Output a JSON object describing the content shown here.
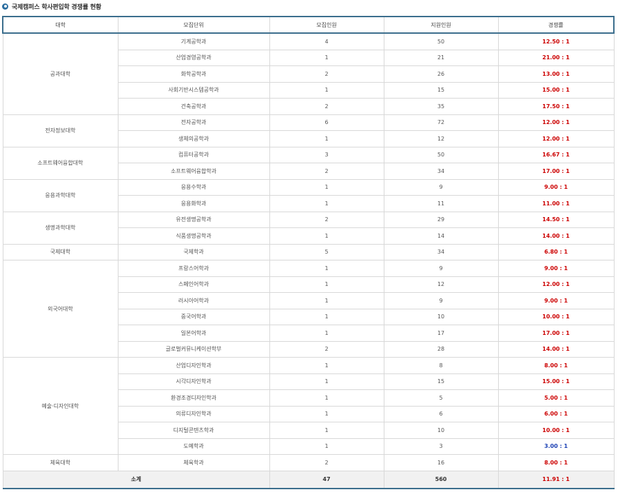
{
  "title": "국제캠퍼스 학사편입학 경쟁률 현황",
  "headers": [
    "대학",
    "모집단위",
    "모집인원",
    "지원인원",
    "경쟁률"
  ],
  "colleges": [
    {
      "name": "공과대학",
      "rows": [
        {
          "dept": "기계공학과",
          "quota": "4",
          "applicants": "50",
          "rate": "12.50 : 1"
        },
        {
          "dept": "산업경영공학과",
          "quota": "1",
          "applicants": "21",
          "rate": "21.00 : 1"
        },
        {
          "dept": "화학공학과",
          "quota": "2",
          "applicants": "26",
          "rate": "13.00 : 1"
        },
        {
          "dept": "사회기반시스템공학과",
          "quota": "1",
          "applicants": "15",
          "rate": "15.00 : 1"
        },
        {
          "dept": "건축공학과",
          "quota": "2",
          "applicants": "35",
          "rate": "17.50 : 1"
        }
      ]
    },
    {
      "name": "전자정보대학",
      "rows": [
        {
          "dept": "전자공학과",
          "quota": "6",
          "applicants": "72",
          "rate": "12.00 : 1"
        },
        {
          "dept": "생체의공학과",
          "quota": "1",
          "applicants": "12",
          "rate": "12.00 : 1"
        }
      ]
    },
    {
      "name": "소프트웨어융합대학",
      "rows": [
        {
          "dept": "컴퓨터공학과",
          "quota": "3",
          "applicants": "50",
          "rate": "16.67 : 1"
        },
        {
          "dept": "소프트웨어융합학과",
          "quota": "2",
          "applicants": "34",
          "rate": "17.00 : 1"
        }
      ]
    },
    {
      "name": "응용과학대학",
      "rows": [
        {
          "dept": "응용수학과",
          "quota": "1",
          "applicants": "9",
          "rate": "9.00 : 1"
        },
        {
          "dept": "응용화학과",
          "quota": "1",
          "applicants": "11",
          "rate": "11.00 : 1"
        }
      ]
    },
    {
      "name": "생명과학대학",
      "rows": [
        {
          "dept": "유전생명공학과",
          "quota": "2",
          "applicants": "29",
          "rate": "14.50 : 1"
        },
        {
          "dept": "식품생명공학과",
          "quota": "1",
          "applicants": "14",
          "rate": "14.00 : 1"
        }
      ]
    },
    {
      "name": "국제대학",
      "rows": [
        {
          "dept": "국제학과",
          "quota": "5",
          "applicants": "34",
          "rate": "6.80 : 1"
        }
      ]
    },
    {
      "name": "외국어대학",
      "rows": [
        {
          "dept": "프랑스어학과",
          "quota": "1",
          "applicants": "9",
          "rate": "9.00 : 1"
        },
        {
          "dept": "스페인어학과",
          "quota": "1",
          "applicants": "12",
          "rate": "12.00 : 1"
        },
        {
          "dept": "러시아어학과",
          "quota": "1",
          "applicants": "9",
          "rate": "9.00 : 1"
        },
        {
          "dept": "중국어학과",
          "quota": "1",
          "applicants": "10",
          "rate": "10.00 : 1"
        },
        {
          "dept": "일본어학과",
          "quota": "1",
          "applicants": "17",
          "rate": "17.00 : 1"
        },
        {
          "dept": "글로벌커뮤니케이션학부",
          "quota": "2",
          "applicants": "28",
          "rate": "14.00 : 1"
        }
      ]
    },
    {
      "name": "예술·디자인대학",
      "rows": [
        {
          "dept": "산업디자인학과",
          "quota": "1",
          "applicants": "8",
          "rate": "8.00 : 1"
        },
        {
          "dept": "시각디자인학과",
          "quota": "1",
          "applicants": "15",
          "rate": "15.00 : 1"
        },
        {
          "dept": "환경조경디자인학과",
          "quota": "1",
          "applicants": "5",
          "rate": "5.00 : 1"
        },
        {
          "dept": "의류디자인학과",
          "quota": "1",
          "applicants": "6",
          "rate": "6.00 : 1"
        },
        {
          "dept": "디지털콘텐츠학과",
          "quota": "1",
          "applicants": "10",
          "rate": "10.00 : 1"
        },
        {
          "dept": "도예학과",
          "quota": "1",
          "applicants": "3",
          "rate": "3.00 : 1",
          "blue": true
        }
      ]
    },
    {
      "name": "체육대학",
      "rows": [
        {
          "dept": "체육학과",
          "quota": "2",
          "applicants": "16",
          "rate": "8.00 : 1"
        }
      ]
    }
  ],
  "total": {
    "label": "소계",
    "quota": "47",
    "applicants": "560",
    "rate": "11.91 : 1"
  },
  "colors": {
    "rate_red": "#cc0000",
    "rate_blue": "#1a3fb3",
    "header_border": "#3a6d8c"
  }
}
